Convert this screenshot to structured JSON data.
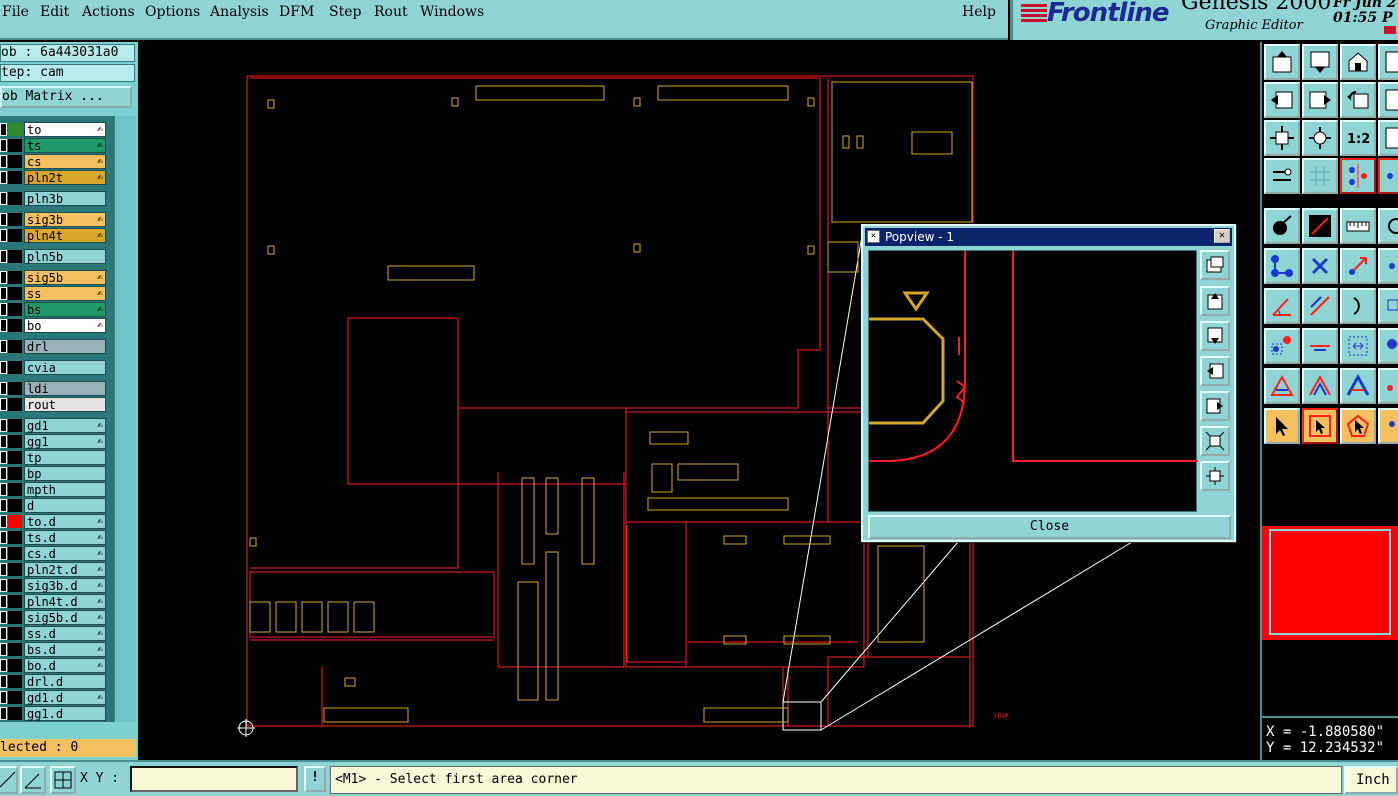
{
  "menubar": {
    "items": [
      "File",
      "Edit",
      "Actions",
      "Options",
      "Analysis",
      "DFM",
      "Step",
      "Rout",
      "Windows"
    ],
    "help": "Help"
  },
  "brand": {
    "logo": "Frontline",
    "product": "Genesis 2000",
    "subtitle": "Graphic Editor",
    "date_fragment": "Fr Jun 2",
    "time": "01:55 P"
  },
  "job": {
    "job_line": "ob : 6a443031a0",
    "step_line": "tep: cam",
    "job_matrix_button": "ob Matrix ...",
    "selected": "lected : 0"
  },
  "layers": [
    {
      "name": "to",
      "color": "#2e8b2e",
      "bg": "#ffffff",
      "edit": true
    },
    {
      "name": "ts",
      "color": "#000000",
      "bg": "#1e9a6a",
      "edit": true
    },
    {
      "name": "cs",
      "color": "#000000",
      "bg": "#f5c060",
      "edit": true
    },
    {
      "name": "pln2t",
      "color": "#000000",
      "bg": "#d9a62a",
      "edit": true
    },
    {
      "name": "pln3b",
      "color": "#000000",
      "bg": "#8fd3d3",
      "edit": false
    },
    {
      "name": "sig3b",
      "color": "#000000",
      "bg": "#f5c060",
      "edit": true
    },
    {
      "name": "pln4t",
      "color": "#000000",
      "bg": "#d9a62a",
      "edit": true
    },
    {
      "name": "pln5b",
      "color": "#000000",
      "bg": "#8fd3d3",
      "edit": false
    },
    {
      "name": "sig5b",
      "color": "#000000",
      "bg": "#f5c060",
      "edit": true
    },
    {
      "name": "ss",
      "color": "#000000",
      "bg": "#f5c060",
      "edit": true
    },
    {
      "name": "bs",
      "color": "#000000",
      "bg": "#1e9a6a",
      "edit": true
    },
    {
      "name": "bo",
      "color": "#000000",
      "bg": "#ffffff",
      "edit": true
    },
    {
      "name": "drl",
      "color": "#000000",
      "bg": "#9ab0b8",
      "edit": false
    },
    {
      "name": "cvia",
      "color": "#000000",
      "bg": "#8fd3d3",
      "edit": false
    },
    {
      "name": "ldi",
      "color": "#000000",
      "bg": "#9ab0b8",
      "edit": false
    },
    {
      "name": "rout",
      "color": "#000000",
      "bg": "#e4e4e4",
      "edit": false
    },
    {
      "name": "gd1",
      "color": "#000000",
      "bg": "#8fd3d3",
      "edit": true
    },
    {
      "name": "gg1",
      "color": "#000000",
      "bg": "#8fd3d3",
      "edit": true
    },
    {
      "name": "tp",
      "color": "#000000",
      "bg": "#8fd3d3",
      "edit": false
    },
    {
      "name": "bp",
      "color": "#000000",
      "bg": "#8fd3d3",
      "edit": false
    },
    {
      "name": "mpth",
      "color": "#000000",
      "bg": "#8fd3d3",
      "edit": false
    },
    {
      "name": "d",
      "color": "#000000",
      "bg": "#8fd3d3",
      "edit": false
    },
    {
      "name": "to.d",
      "color": "#ff0000",
      "bg": "#8fd3d3",
      "edit": true
    },
    {
      "name": "ts.d",
      "color": "#000000",
      "bg": "#8fd3d3",
      "edit": true
    },
    {
      "name": "cs.d",
      "color": "#000000",
      "bg": "#8fd3d3",
      "edit": true
    },
    {
      "name": "pln2t.d",
      "color": "#000000",
      "bg": "#8fd3d3",
      "edit": true
    },
    {
      "name": "sig3b.d",
      "color": "#000000",
      "bg": "#8fd3d3",
      "edit": true
    },
    {
      "name": "pln4t.d",
      "color": "#000000",
      "bg": "#8fd3d3",
      "edit": true
    },
    {
      "name": "sig5b.d",
      "color": "#000000",
      "bg": "#8fd3d3",
      "edit": true
    },
    {
      "name": "ss.d",
      "color": "#000000",
      "bg": "#8fd3d3",
      "edit": true
    },
    {
      "name": "bs.d",
      "color": "#000000",
      "bg": "#8fd3d3",
      "edit": true
    },
    {
      "name": "bo.d",
      "color": "#000000",
      "bg": "#8fd3d3",
      "edit": true
    },
    {
      "name": "drl.d",
      "color": "#000000",
      "bg": "#8fd3d3",
      "edit": false
    },
    {
      "name": "gd1.d",
      "color": "#000000",
      "bg": "#8fd3d3",
      "edit": true
    },
    {
      "name": "gg1.d",
      "color": "#000000",
      "bg": "#8fd3d3",
      "edit": false
    }
  ],
  "layer_edit_glyph": "✍",
  "popview": {
    "title": "Popview - 1",
    "close_button": "Close"
  },
  "coords": {
    "x": "X = -1.880580\"",
    "y": "Y = 12.234532\""
  },
  "bottombar": {
    "xy_label": "X Y :",
    "xy_value": "",
    "warn": "!",
    "prompt": "<M1> - Select first area corner",
    "units": "Inch"
  },
  "colors": {
    "panel": "#8fd3d3",
    "outline_red": "#ff0000",
    "component_gold": "#d4a72c"
  }
}
